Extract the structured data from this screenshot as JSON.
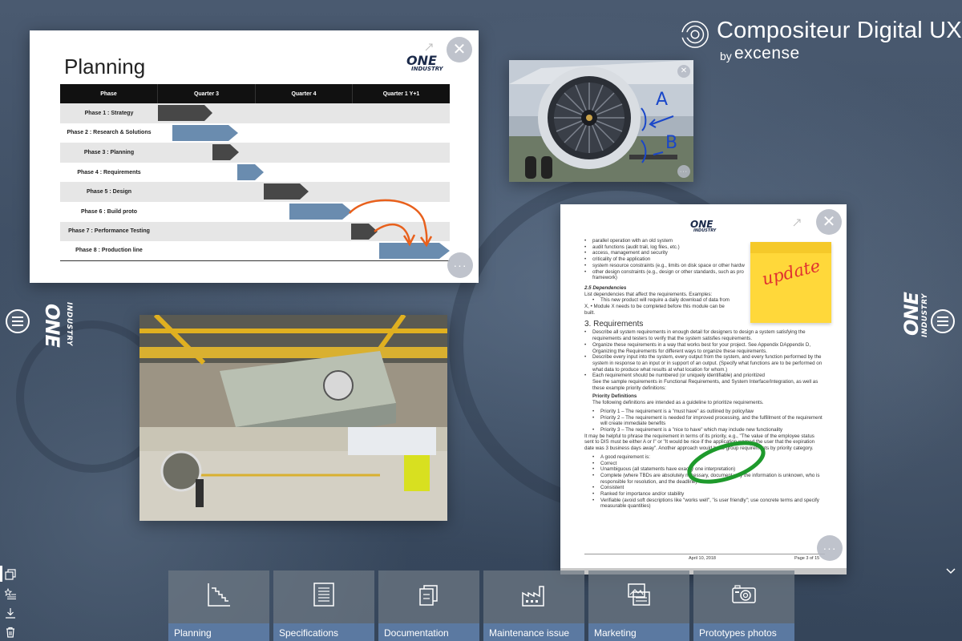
{
  "brand": {
    "title": "Compositeur Digital UX",
    "by": "by",
    "subtitle": "excense"
  },
  "side_logo": {
    "one": "ONE",
    "industry": "INDUSTRY"
  },
  "planning_card": {
    "title": "Planning",
    "logo_one": "ONE",
    "logo_industry": "INDUSTRY",
    "columns": [
      "Phase",
      "Quarter 3",
      "Quarter 4",
      "Quarter 1 Y+1"
    ],
    "phases": [
      "Phase 1 : Strategy",
      "Phase 2 : Research & Solutions",
      "Phase 3 : Planning",
      "Phase 4 : Requirements",
      "Phase 5 : Design",
      "Phase 6 : Build proto",
      "Phase 7 : Performance Testing",
      "Phase 8 : Production line"
    ],
    "bar_colors": [
      "#474747",
      "#6a8caf",
      "#474747",
      "#6a8caf",
      "#474747",
      "#6a8caf",
      "#474747",
      "#6a8caf"
    ],
    "annotation_color": "#e8601c"
  },
  "engine_card": {
    "annotation_a": "A",
    "annotation_b": "B",
    "annotation_color": "#1a47c9"
  },
  "doc_card": {
    "logo_one": "ONE",
    "logo_industry": "INDUSTRY",
    "sticky_note": "update",
    "lines": {
      "l1": "parallel operation with an old system",
      "l2": "audit functions (audit trail, log files, etc.)",
      "l3": "access, management and security",
      "l4": "criticality of the application",
      "l5": "system resource constraints (e.g., limits on disk space or other hardw",
      "l6": "other design constraints (e.g., design or other standards, such as pro",
      "l6b": "framework)",
      "h25": "2.5    Dependencies",
      "dep": "List dependencies that affect the requirements.  Examples:",
      "dep1": "This new product will require a daily download of data from",
      "dep2": "X, •    Module X needs to be completed before this module can be",
      "dep3": "built.",
      "h3": "3. Requirements",
      "r1": "Describe all system requirements in enough detail for designers to design a system satisfying the requirements and testers to verify that the system satisfies requirements.",
      "r2": "Organize these requirements in a way that works best for your project.  See Appendix DAppendix D, Organizing the Requirements  for different ways to organize these requirements.",
      "r3": "Describe every input into the system, every output from the system, and every function performed by the system in response to an input or in support of an output.  (Specify what functions are to be performed on what data to produce what results at what location for whom.)",
      "r4": "Each requirement should be numbered (or uniquely identifiable) and prioritized",
      "r4b": "See the sample requirements in Functional Requirements, and System Interface/Integration, as well as these example priority definitions:",
      "pd": "Priority Definitions",
      "pd_text": "The following definitions are intended as a guideline to prioritize requirements.",
      "p1": "Priority 1 – The requirement is a \"must have\" as outlined by policy/law",
      "p2": "Priority 2 – The requirement is needed for improved processing, and the fulfillment of the requirement will create immediate benefits",
      "p3": "Priority 3 – The requirement is a \"nice to have\" which may include new functionality",
      "p3b": "It may be helpful to phrase the requirement in terms of its priority, e.g., \"The value of the employee status sent to DIS must be either A or I\" or \"It would be nice if the application warned the user that the expiration date was 3 business days away\". Another approach would be to group requirements by priority category.",
      "g0": "A good requirement is:",
      "g1": "Correct",
      "g2": "Unambiguous (all statements have exactly one interpretation)",
      "g3": "Complete (where TBDs are absolutely necessary, document why the information is unknown, who is responsible for resolution, and the deadline)",
      "g4": "Consistent",
      "g5": "Ranked for importance and/or stability",
      "g6": "Verifiable (avoid soft descriptions like \"works well\", \"is user friendly\"; use concrete terms and specify measurable quantities)"
    },
    "footer_date": "April 10, 2018",
    "footer_page": "Page 3 of 15"
  },
  "tiles": [
    {
      "label": "Planning",
      "icon": "staircase-chart-icon"
    },
    {
      "label": "Specifications",
      "icon": "document-list-icon"
    },
    {
      "label": "Documentation",
      "icon": "documents-stack-icon"
    },
    {
      "label": "Maintenance issue",
      "icon": "factory-icon"
    },
    {
      "label": "Marketing",
      "icon": "image-gallery-icon"
    },
    {
      "label": "Prototypes photos",
      "icon": "camera-icon"
    }
  ],
  "close_symbol": "✕",
  "more_symbol": "···"
}
